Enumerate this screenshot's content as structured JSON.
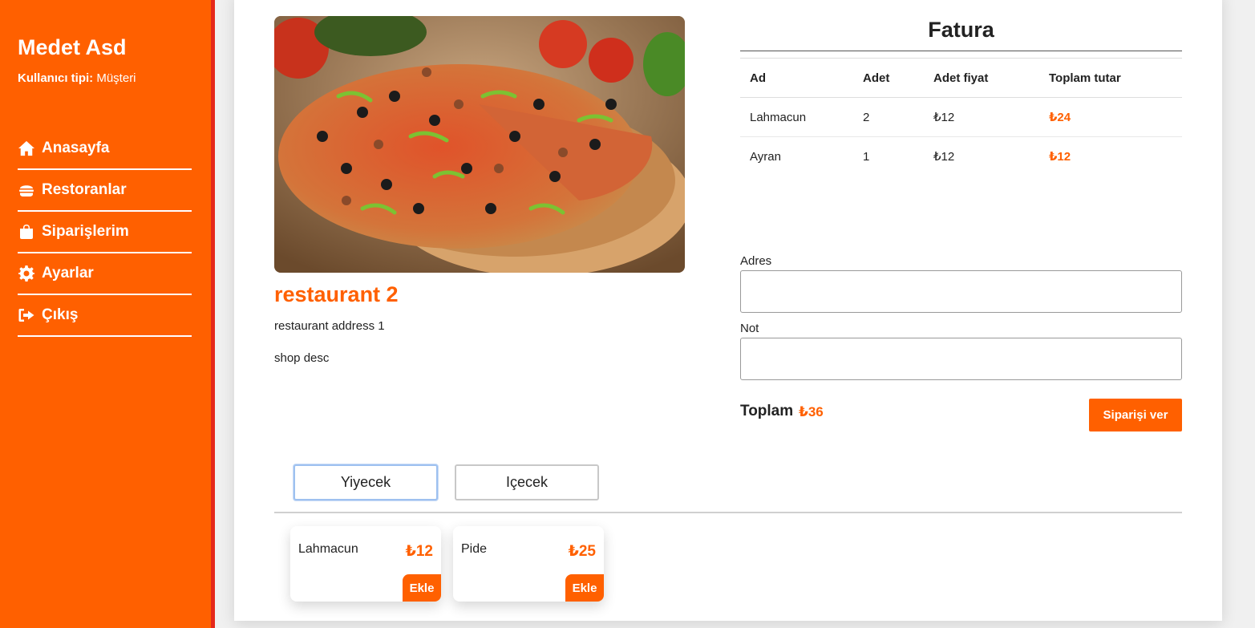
{
  "user": {
    "name": "Medet Asd",
    "type_label": "Kullanıcı tipi:",
    "type_value": "Müşteri"
  },
  "sidebar": {
    "items": [
      {
        "label": "Anasayfa",
        "icon": "home-icon"
      },
      {
        "label": "Restoranlar",
        "icon": "burger-icon"
      },
      {
        "label": "Siparişlerim",
        "icon": "shopping-bag-icon"
      },
      {
        "label": "Ayarlar",
        "icon": "gear-icon"
      },
      {
        "label": "Çıkış",
        "icon": "logout-icon"
      }
    ]
  },
  "restaurant": {
    "name": "restaurant 2",
    "address": "restaurant address 1",
    "description": "shop desc"
  },
  "invoice": {
    "title": "Fatura",
    "headers": {
      "name": "Ad",
      "qty": "Adet",
      "unit_price": "Adet fiyat",
      "total": "Toplam tutar"
    },
    "rows": [
      {
        "name": "Lahmacun",
        "qty": "2",
        "unit_price": "₺12",
        "total": "₺24"
      },
      {
        "name": "Ayran",
        "qty": "1",
        "unit_price": "₺12",
        "total": "₺12"
      }
    ]
  },
  "form": {
    "address_label": "Adres",
    "address_value": "",
    "note_label": "Not",
    "note_value": ""
  },
  "summary": {
    "total_label": "Toplam",
    "total_value": "₺36",
    "order_button": "Siparişi ver"
  },
  "tabs": {
    "food": "Yiyecek",
    "drink": "Içecek",
    "active": "food"
  },
  "menu": [
    {
      "name": "Lahmacun",
      "price": "₺12",
      "button": "Ekle"
    },
    {
      "name": "Pide",
      "price": "₺25",
      "button": "Ekle"
    }
  ],
  "colors": {
    "accent": "#ff6000",
    "sidebar_edge": "#e5281a"
  }
}
